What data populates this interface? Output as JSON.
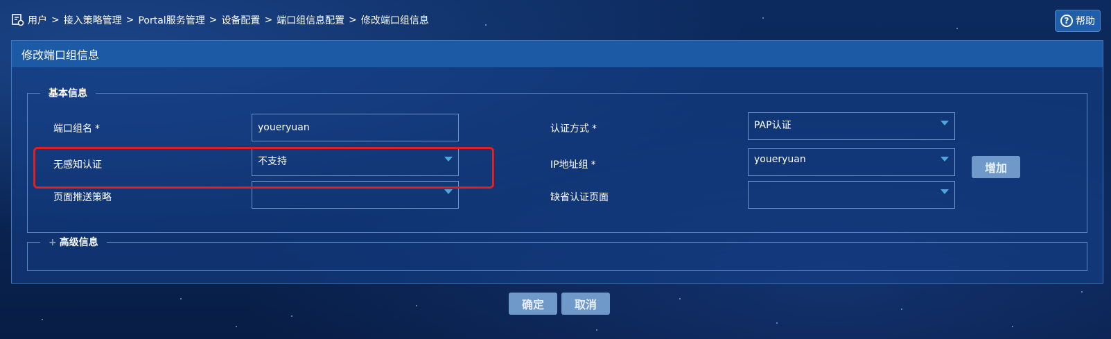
{
  "breadcrumb": {
    "items": [
      "用户",
      "接入策略管理",
      "Portal服务管理",
      "设备配置",
      "端口组信息配置"
    ],
    "current": "修改端口组信息",
    "separator": ">"
  },
  "help": {
    "label": "帮助",
    "icon_symbol": "?"
  },
  "panel": {
    "title": "修改端口组信息"
  },
  "basic": {
    "legend": "基本信息",
    "port_group_name": {
      "label": "端口组名",
      "required_mark": "*",
      "value": "youeryuan"
    },
    "auth_method": {
      "label": "认证方式",
      "required_mark": "*",
      "value": "PAP认证"
    },
    "seamless_auth": {
      "label": "无感知认证",
      "value": "不支持"
    },
    "ip_group": {
      "label": "IP地址组",
      "required_mark": "*",
      "value": "youeryuan"
    },
    "add_button": "增加",
    "page_push_policy": {
      "label": "页面推送策略",
      "value": ""
    },
    "default_auth_page": {
      "label": "缺省认证页面",
      "value": ""
    }
  },
  "advanced": {
    "legend": "高级信息",
    "expand_icon": "+"
  },
  "actions": {
    "ok": "确定",
    "cancel": "取消"
  },
  "colors": {
    "background": "#0a2554",
    "panel_header": "#1d5aa6",
    "button": "#6f99c8",
    "highlight": "#e02020",
    "caret": "#4fa6dc"
  }
}
